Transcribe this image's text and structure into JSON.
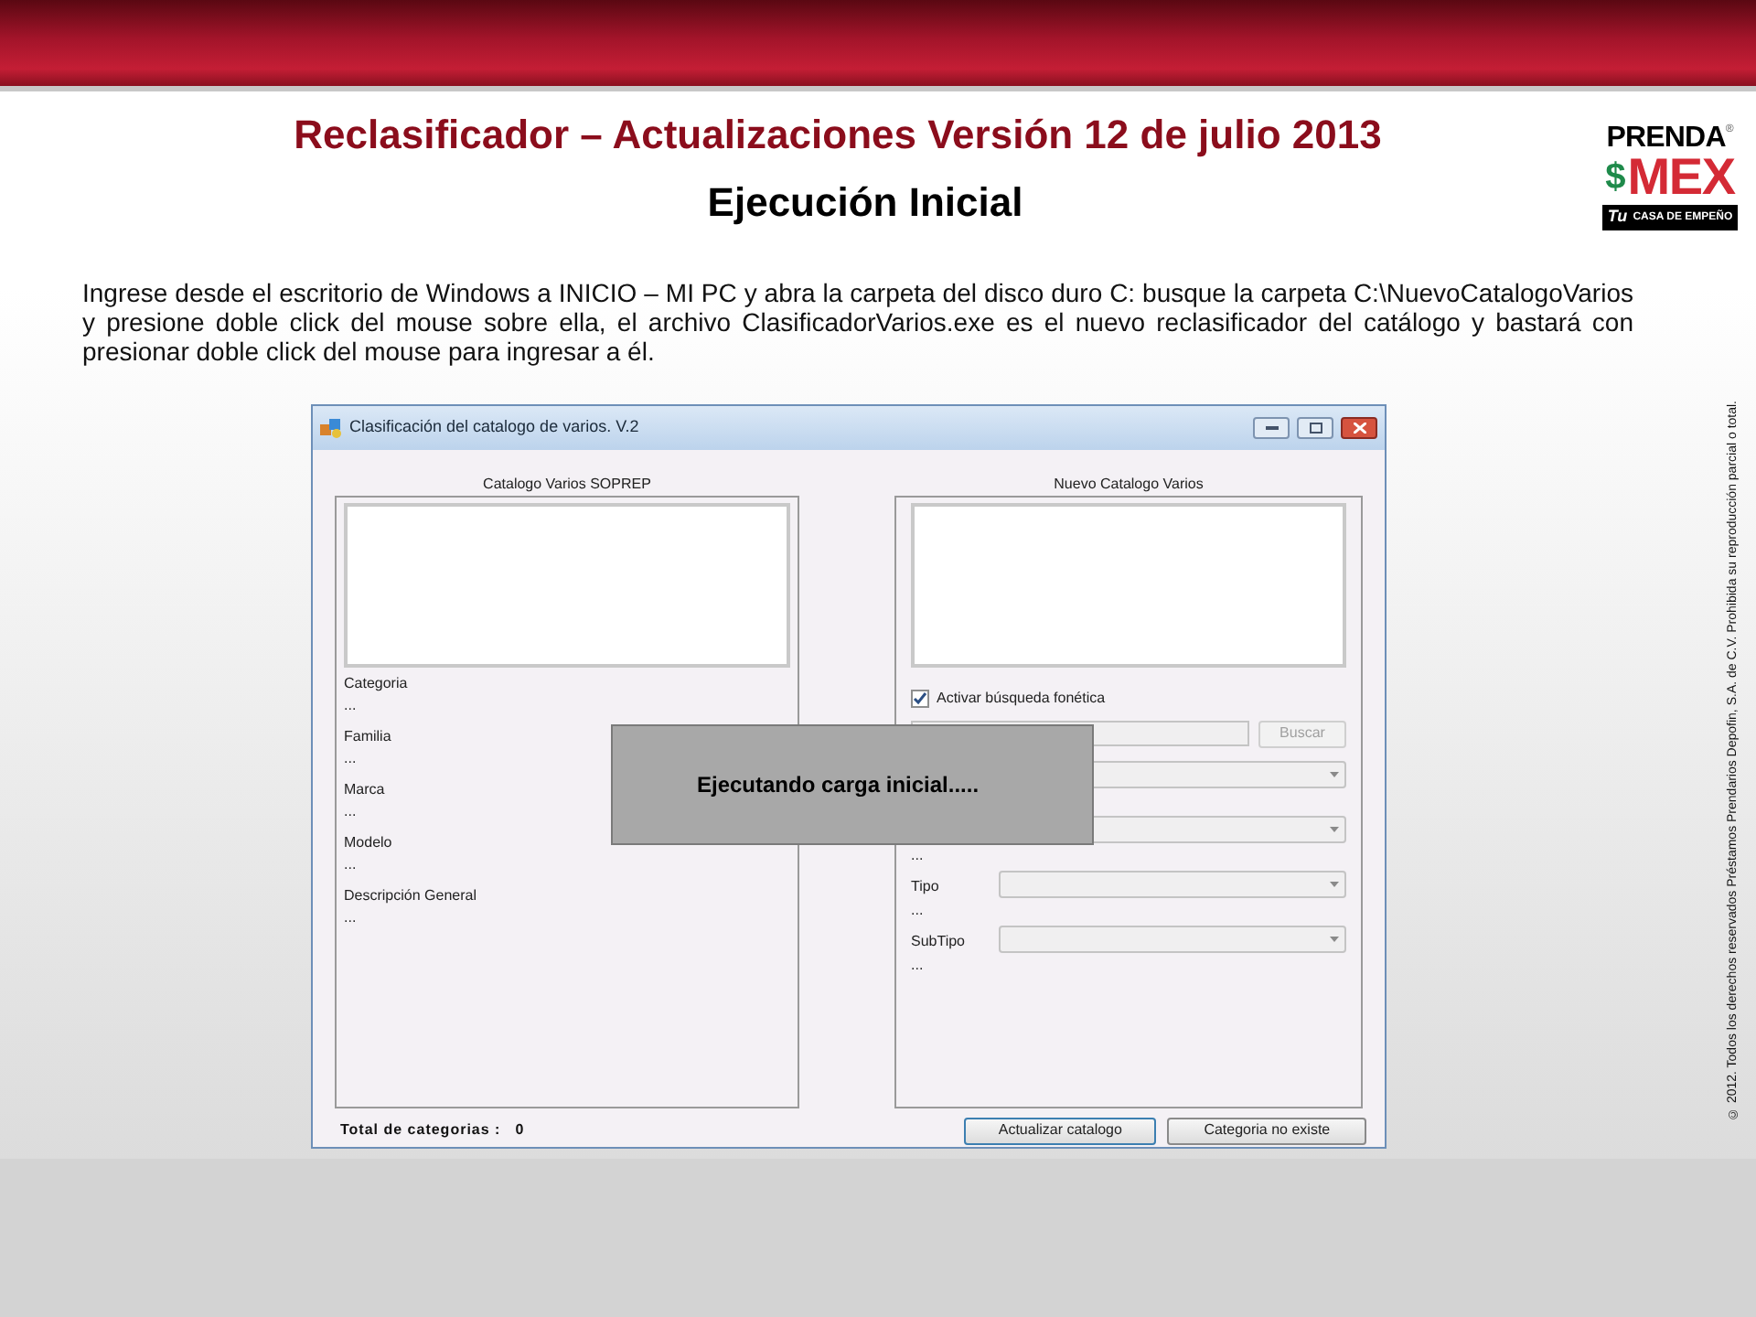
{
  "slide": {
    "title": "Reclasificador – Actualizaciones Versión 12 de julio 2013",
    "subtitle": "Ejecución Inicial",
    "paragraph": "Ingrese desde el escritorio de Windows a INICIO – MI PC y abra la carpeta del disco duro C: busque la carpeta C:\\NuevoCatalogoVarios y presione doble click del mouse sobre ella, el archivo ClasificadorVarios.exe es el nuevo reclasificador del catálogo y bastará con presionar doble click del mouse para ingresar a él."
  },
  "logo": {
    "top": "PRENDA",
    "symbol": "$",
    "registered": "®",
    "bottom": "MEX",
    "tagline_mark": "Tu",
    "tagline": "CASA DE EMPEÑO"
  },
  "copyright": "© 2012. Todos los derechos reservados Préstamos Prendarios Depofin, S.A. de C.V. Prohibida su reproducción parcial o total.",
  "window": {
    "title": "Clasificación del catalogo de varios. V.2",
    "left_panel": {
      "heading": "Catalogo Varios SOPREP",
      "fields": [
        {
          "label": "Categoria",
          "value": "..."
        },
        {
          "label": "Familia",
          "value": "..."
        },
        {
          "label": "Marca",
          "value": "..."
        },
        {
          "label": "Modelo",
          "value": "..."
        },
        {
          "label": "Descripción General",
          "value": "..."
        }
      ]
    },
    "right_panel": {
      "heading": "Nuevo Catalogo Varios",
      "checkbox": {
        "label": "Activar búsqueda fonética",
        "checked": true
      },
      "search_button": {
        "label": "Buscar",
        "disabled": true
      },
      "rows": [
        {
          "kind": "dropdown"
        },
        {
          "kind": "dropdown"
        },
        {
          "kind": "value",
          "text": "..."
        },
        {
          "kind": "dropdown",
          "label": "Tipo"
        },
        {
          "kind": "value",
          "text": "..."
        },
        {
          "kind": "dropdown",
          "label": "SubTipo"
        },
        {
          "kind": "value",
          "text": "..."
        }
      ]
    },
    "total_label": "Total de categorias :",
    "total_value": "0",
    "buttons": [
      {
        "label": "Actualizar catalogo",
        "focused": true
      },
      {
        "label": "Categoria no existe",
        "focused": false
      }
    ],
    "overlay": {
      "message": "Ejecutando carga inicial....."
    }
  }
}
